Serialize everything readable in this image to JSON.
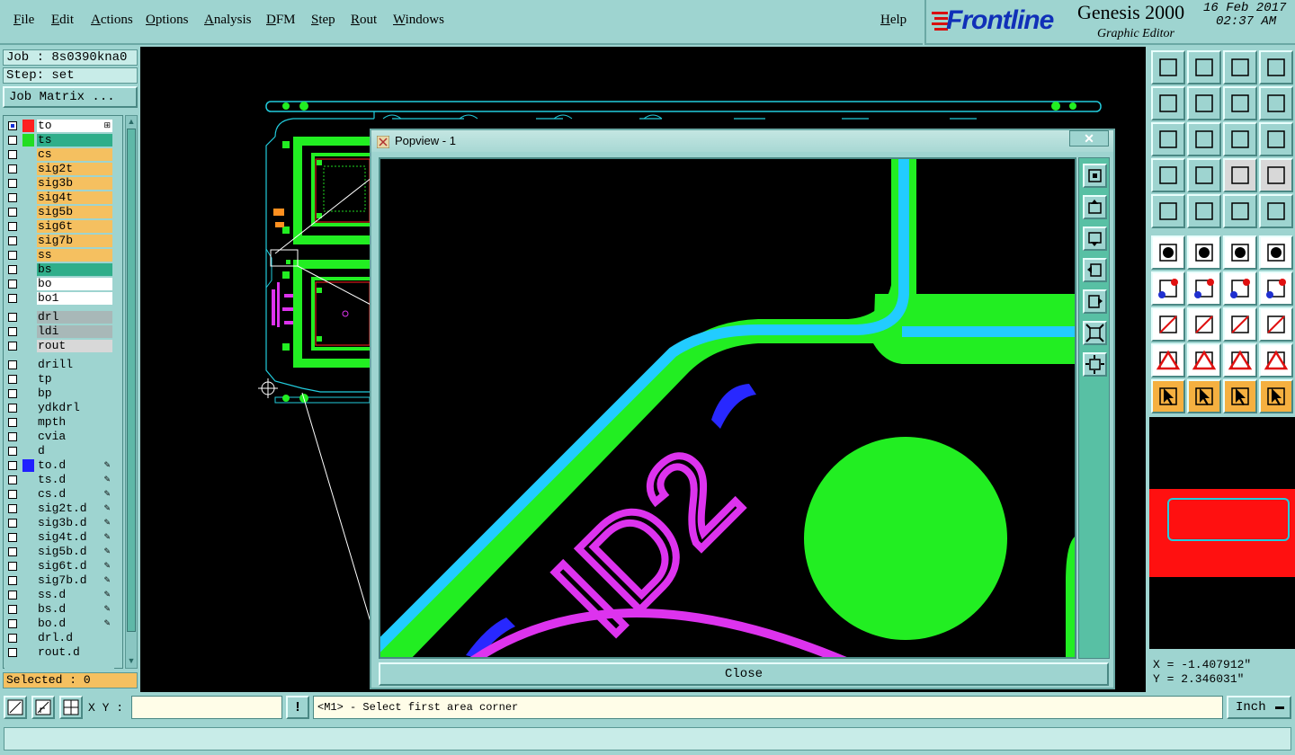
{
  "menubar": {
    "items": [
      "File",
      "Edit",
      "Actions",
      "Options",
      "Analysis",
      "DFM",
      "Step",
      "Rout",
      "Windows"
    ],
    "help": "Help"
  },
  "brand": {
    "logo": "Frontline",
    "product": "Genesis 2000",
    "subtitle": "Graphic Editor",
    "date": "16 Feb 2017",
    "time": "02:37 AM"
  },
  "job": {
    "job_label": "Job : 8s0390kna0",
    "step_label": "Step: set",
    "matrix_button": "Job Matrix ..."
  },
  "layers": [
    {
      "name": "to",
      "bg": "#ffffff",
      "swatch": "#ff2020",
      "selected": true,
      "icon": "grid"
    },
    {
      "name": "ts",
      "bg": "#2fae8a",
      "swatch": "#22dd22"
    },
    {
      "name": "cs",
      "bg": "#f5c060"
    },
    {
      "name": "sig2t",
      "bg": "#f5c060"
    },
    {
      "name": "sig3b",
      "bg": "#f5c060"
    },
    {
      "name": "sig4t",
      "bg": "#f5c060"
    },
    {
      "name": "sig5b",
      "bg": "#f5c060"
    },
    {
      "name": "sig6t",
      "bg": "#f5c060"
    },
    {
      "name": "sig7b",
      "bg": "#f5c060"
    },
    {
      "name": "ss",
      "bg": "#f5c060"
    },
    {
      "name": "bs",
      "bg": "#2fae8a"
    },
    {
      "name": "bo",
      "bg": "#ffffff"
    },
    {
      "name": "bo1",
      "bg": "#ffffff"
    },
    {
      "gap": true
    },
    {
      "name": "drl",
      "bg": "#a8b8b8"
    },
    {
      "name": "ldi",
      "bg": "#a8b8b8"
    },
    {
      "name": "rout",
      "bg": "#d8d8d8"
    },
    {
      "gap": true
    },
    {
      "name": "drill",
      "bg": "#9ed4d0"
    },
    {
      "name": "tp",
      "bg": "#9ed4d0"
    },
    {
      "name": "bp",
      "bg": "#9ed4d0"
    },
    {
      "name": "ydkdrl",
      "bg": "#9ed4d0"
    },
    {
      "name": "mpth",
      "bg": "#9ed4d0"
    },
    {
      "name": "cvia",
      "bg": "#9ed4d0"
    },
    {
      "name": "d",
      "bg": "#9ed4d0"
    },
    {
      "name": "to.d",
      "bg": "#9ed4d0",
      "swatch": "#2020ff",
      "icon": "edit"
    },
    {
      "name": "ts.d",
      "bg": "#9ed4d0",
      "icon": "edit"
    },
    {
      "name": "cs.d",
      "bg": "#9ed4d0",
      "icon": "edit"
    },
    {
      "name": "sig2t.d",
      "bg": "#9ed4d0",
      "icon": "edit"
    },
    {
      "name": "sig3b.d",
      "bg": "#9ed4d0",
      "icon": "edit"
    },
    {
      "name": "sig4t.d",
      "bg": "#9ed4d0",
      "icon": "edit"
    },
    {
      "name": "sig5b.d",
      "bg": "#9ed4d0",
      "icon": "edit"
    },
    {
      "name": "sig6t.d",
      "bg": "#9ed4d0",
      "icon": "edit"
    },
    {
      "name": "sig7b.d",
      "bg": "#9ed4d0",
      "icon": "edit"
    },
    {
      "name": "ss.d",
      "bg": "#9ed4d0",
      "icon": "edit"
    },
    {
      "name": "bs.d",
      "bg": "#9ed4d0",
      "icon": "edit"
    },
    {
      "name": "bo.d",
      "bg": "#9ed4d0",
      "icon": "edit"
    },
    {
      "name": "drl.d",
      "bg": "#9ed4d0"
    },
    {
      "name": "rout.d",
      "bg": "#9ed4d0"
    }
  ],
  "selected_label": "Selected : 0",
  "popup": {
    "title": "Popview - 1",
    "close_label": "Close",
    "text_feature": "ID2"
  },
  "coords": {
    "x": "X = -1.407912\"",
    "y": "Y = 2.346031\""
  },
  "status": {
    "xy_label": "X Y :",
    "xy_value": "",
    "prompt": "<M1> - Select first area corner",
    "units": "Inch"
  },
  "colors": {
    "ui_bg": "#9ed4d0",
    "green": "#22ee22",
    "cyan": "#22ddee",
    "magenta": "#dd33ee",
    "red": "#ff1010"
  }
}
